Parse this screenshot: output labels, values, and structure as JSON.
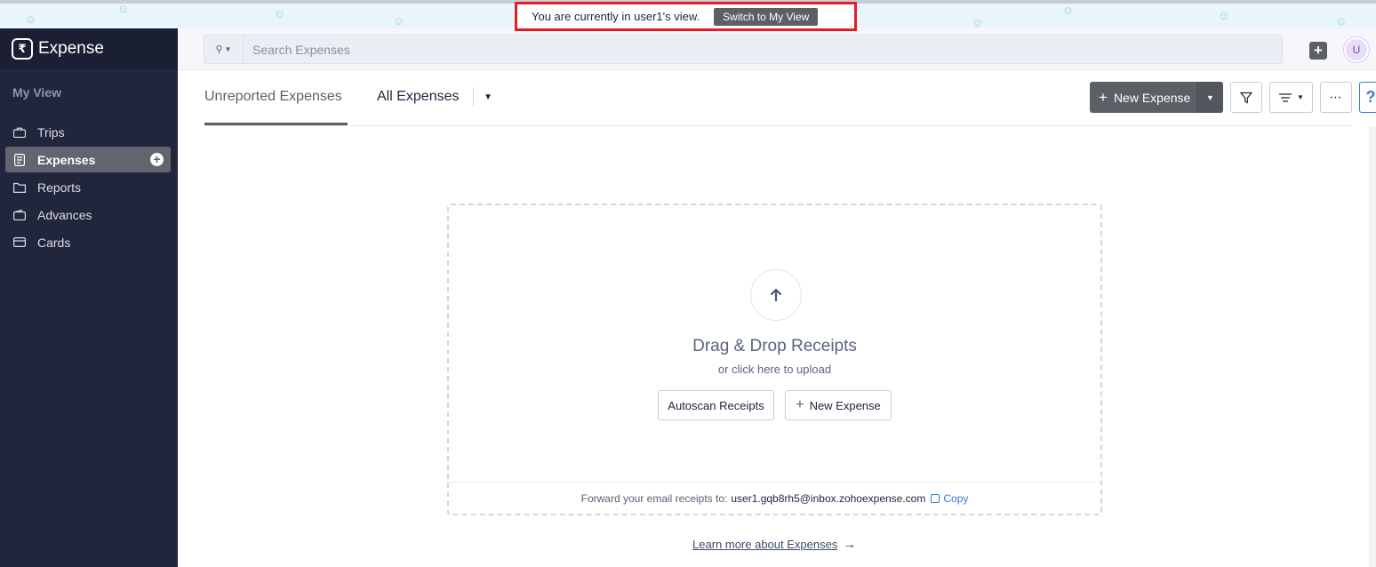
{
  "banner": {
    "text": "You are currently in user1's view.",
    "switch_label": "Switch to My View"
  },
  "app": {
    "name": "Expense"
  },
  "sidebar": {
    "section": "My View",
    "items": [
      {
        "label": "Trips",
        "icon": "briefcase-icon"
      },
      {
        "label": "Expenses",
        "icon": "receipt-icon",
        "active": true
      },
      {
        "label": "Reports",
        "icon": "folder-icon"
      },
      {
        "label": "Advances",
        "icon": "wallet-icon"
      },
      {
        "label": "Cards",
        "icon": "card-icon"
      }
    ]
  },
  "header": {
    "search_placeholder": "Search Expenses",
    "avatar_initial": "U"
  },
  "tabs": {
    "unreported": "Unreported Expenses",
    "all": "All Expenses"
  },
  "toolbar": {
    "new_expense": "New Expense"
  },
  "dropzone": {
    "title": "Drag & Drop Receipts",
    "subtitle": "or click here to upload",
    "autoscan": "Autoscan Receipts",
    "new_expense": "New Expense",
    "forward_text": "Forward your email receipts to:",
    "email": "user1.gqb8rh5@inbox.zohoexpense.com",
    "copy": "Copy"
  },
  "learn_more": "Learn more about Expenses",
  "colors": {
    "sidebar_bg": "#21263c",
    "accent_button": "#5b6067",
    "banner_highlight": "#e01e26",
    "link_blue": "#3778d6"
  }
}
